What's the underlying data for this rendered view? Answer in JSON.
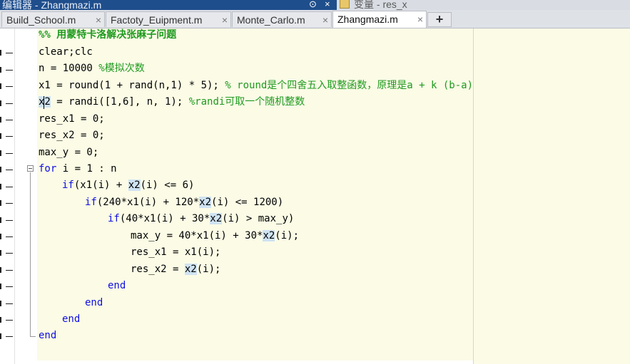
{
  "window": {
    "title": "编辑器 - Zhangmazi.m",
    "dropdown_icon": "⊙",
    "close_icon": "×",
    "secondary_panel_title": "变量 - res_x"
  },
  "tabs": [
    {
      "label": "Build_School.m",
      "active": false
    },
    {
      "label": "Factoty_Euipment.m",
      "active": false
    },
    {
      "label": "Monte_Carlo.m",
      "active": false
    },
    {
      "label": "Zhangmazi.m",
      "active": true
    }
  ],
  "tab_close_glyph": "×",
  "tab_add_glyph": "+",
  "code": {
    "l1": {
      "cmt": "%% 用蒙特卡洛解决张麻子问题"
    },
    "l2": {
      "code": "clear;clc"
    },
    "l3": {
      "code": "n = 10000 ",
      "cmt": "%模拟次数"
    },
    "l4": {
      "code": "x1 = round(1 + rand(n,1) * 5); ",
      "cmt": "% round是个四舍五入取整函数，原理是a + k (b-a)"
    },
    "l5": {
      "v": "x2",
      "code": " = randi([1,6], n, 1); ",
      "cmt": "%randi可取一个随机整数"
    },
    "l6": {
      "code": "res_x1 = 0;"
    },
    "l7": {
      "code": "res_x2 = 0;"
    },
    "l8": {
      "code": "max_y = 0;"
    },
    "l9": {
      "kw": "for",
      "code": " i = 1 : n"
    },
    "l10": {
      "kw": "if",
      "a": "(x1(i) + ",
      "v": "x2",
      "b": "(i) <= 6)"
    },
    "l11": {
      "kw": "if",
      "a": "(240*x1(i) + 120*",
      "v": "x2",
      "b": "(i) <= 1200)"
    },
    "l12": {
      "kw": "if",
      "a": "(40*x1(i) + 30*",
      "v": "x2",
      "b": "(i) > max_y)"
    },
    "l13": {
      "a": "max_y = 40*x1(i) + 30*",
      "v": "x2",
      "b": "(i);"
    },
    "l14": {
      "code": "res_x1 = x1(i);"
    },
    "l15": {
      "a": "res_x2 = ",
      "v": "x2",
      "b": "(i);"
    },
    "l16": {
      "kw": "end"
    },
    "l17": {
      "kw": "end"
    },
    "l18": {
      "kw": "end"
    },
    "l19": {
      "kw": "end"
    }
  }
}
